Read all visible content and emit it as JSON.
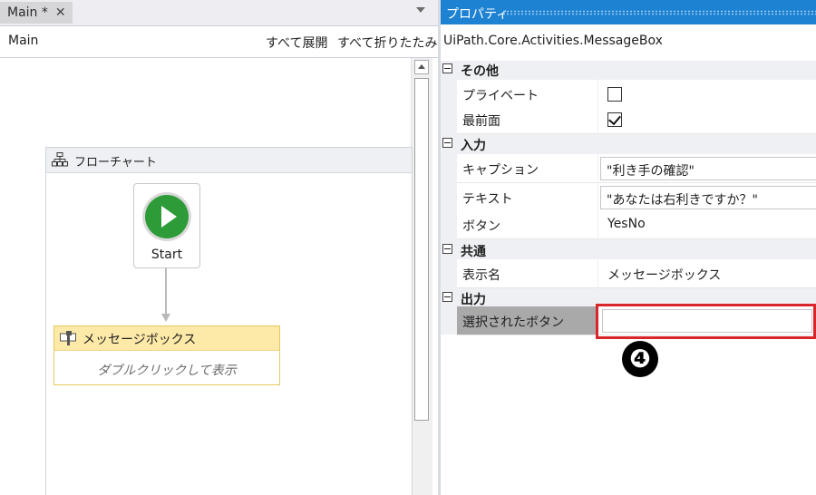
{
  "tab": {
    "label": "Main *",
    "close_icon": "✕"
  },
  "designer": {
    "breadcrumb": "Main",
    "expand_all": "すべて展開",
    "collapse_all": "すべて折りたたみ"
  },
  "flowchart": {
    "title": "フローチャート",
    "icon": "flowchart-icon"
  },
  "start_node": {
    "label": "Start",
    "color": "#2e9b39"
  },
  "activity": {
    "title": "メッセージボックス",
    "hint": "ダブルクリックして表示",
    "icon": "message-box-icon"
  },
  "properties": {
    "panel_title": "プロパティ",
    "activity_type": "UiPath.Core.Activities.MessageBox",
    "categories": {
      "misc": {
        "label": "その他",
        "private": "プライベート",
        "private_checked": false,
        "topmost": "最前面",
        "topmost_checked": true
      },
      "input": {
        "label": "入力",
        "caption": "キャプション",
        "caption_value": "\"利き手の確認\"",
        "text": "テキスト",
        "text_value": "\"あなたは右利きですか？\"",
        "buttons": "ボタン",
        "buttons_value": "YesNo"
      },
      "common": {
        "label": "共通",
        "display_name": "表示名",
        "display_name_value": "メッセージボックス"
      },
      "output": {
        "label": "出力",
        "chosen_button": "選択されたボタン",
        "chosen_button_value": ""
      }
    }
  },
  "annotation": {
    "step": "❹",
    "highlight_color": "#d9262a"
  }
}
